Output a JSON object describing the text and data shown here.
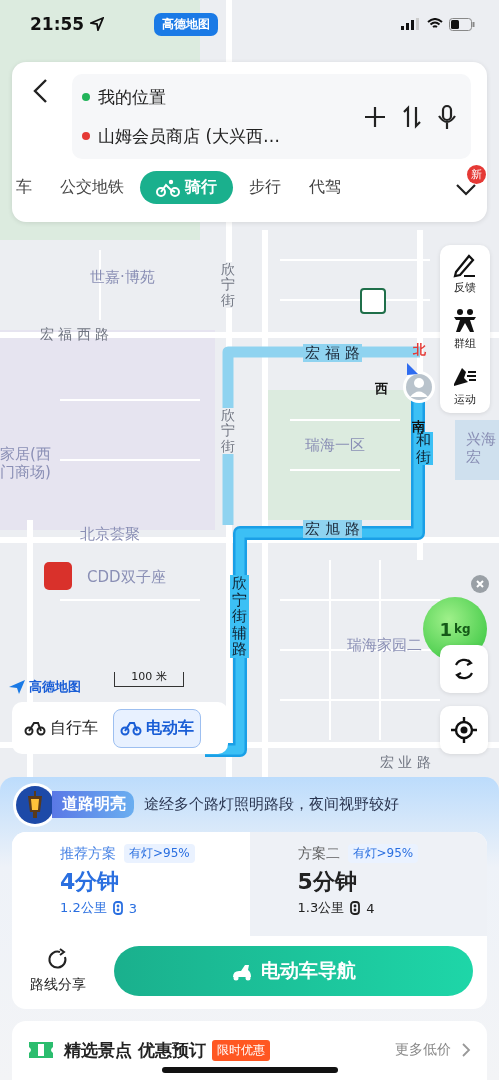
{
  "status_bar": {
    "time": "21:55",
    "back_app": "高德地图"
  },
  "search": {
    "origin": "我的位置",
    "destination": "山姆会员商店 (大兴西…"
  },
  "modes": [
    {
      "label": "车",
      "selected": false
    },
    {
      "label": "公交地铁",
      "selected": false
    },
    {
      "label": "骑行",
      "selected": true
    },
    {
      "label": "步行",
      "selected": false
    },
    {
      "label": "代驾",
      "selected": false
    }
  ],
  "more_badge": "新",
  "map": {
    "labels": [
      {
        "text": "世嘉·博苑",
        "kind": "place"
      },
      {
        "text": "宏 福 西 路",
        "kind": "road"
      },
      {
        "text": "欣宁街",
        "kind": "road-v"
      },
      {
        "text": "宏 福 路",
        "kind": "route"
      },
      {
        "text": "欣宁街",
        "kind": "road-v"
      },
      {
        "text": "瑞海一区",
        "kind": "place"
      },
      {
        "text": "家居(西门商场)",
        "kind": "place-wrap"
      },
      {
        "text": "和街",
        "kind": "route-v"
      },
      {
        "text": "兴海宏",
        "kind": "place-stack"
      },
      {
        "text": "北京荟聚",
        "kind": "place"
      },
      {
        "text": "宏 旭 路",
        "kind": "route"
      },
      {
        "text": "CDD双子座",
        "kind": "place"
      },
      {
        "text": "欣宁街辅路",
        "kind": "route-v"
      },
      {
        "text": "瑞海家园二",
        "kind": "place"
      },
      {
        "text": "宏 业 路",
        "kind": "road"
      }
    ],
    "compass": [
      {
        "text": "北",
        "kind": "north"
      },
      {
        "text": "西",
        "kind": "side"
      },
      {
        "text": "南",
        "kind": "side"
      }
    ],
    "scale": "100 米",
    "logo": "高德地图"
  },
  "side_tools": [
    {
      "label": "反馈"
    },
    {
      "label": "群组"
    },
    {
      "label": "运动"
    }
  ],
  "carbon_bubble": {
    "value": "1",
    "unit": "kg"
  },
  "vehicle_types": [
    {
      "label": "自行车",
      "selected": false
    },
    {
      "label": "电动车",
      "selected": true
    }
  ],
  "highlight": {
    "badge": "道路明亮",
    "text": "途经多个路灯照明路段，夜间视野较好"
  },
  "routes": [
    {
      "name": "推荐方案",
      "tag": "有灯>95%",
      "duration": "4分钟",
      "distance": "1.2公里",
      "lights": "3",
      "selected": true
    },
    {
      "name": "方案二",
      "tag": "有灯>95%",
      "duration": "5分钟",
      "distance": "1.3公里",
      "lights": "4",
      "selected": false
    }
  ],
  "share_label": "路线分享",
  "nav_button": "电动车导航",
  "promo": {
    "title": "精选景点 优惠预订",
    "tag": "限时优惠",
    "more": "更多低价"
  }
}
